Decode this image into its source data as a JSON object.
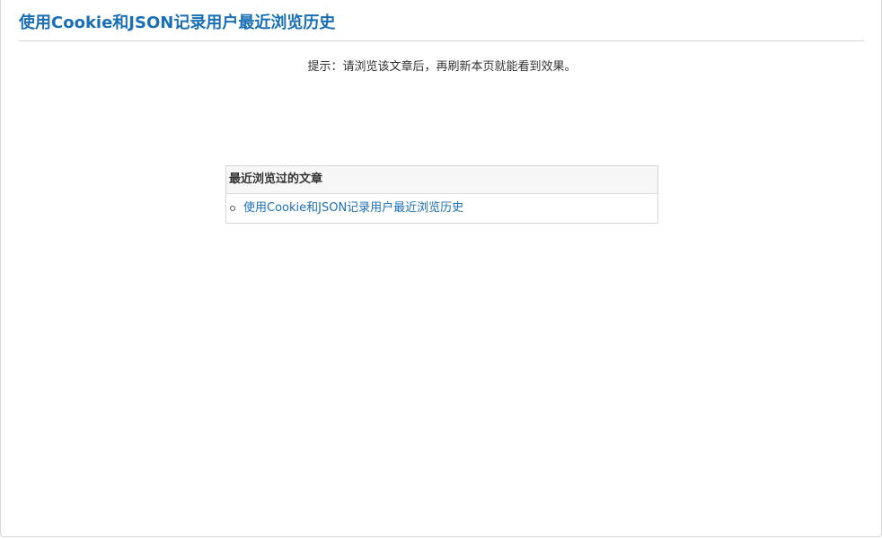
{
  "header": {
    "title": "使用Cookie和JSON记录用户最近浏览历史"
  },
  "hint": {
    "text": "提示：请浏览该文章后，再刷新本页就能看到效果。"
  },
  "history": {
    "heading": "最近浏览过的文章",
    "items": [
      {
        "label": "使用Cookie和JSON记录用户最近浏览历史"
      }
    ]
  }
}
